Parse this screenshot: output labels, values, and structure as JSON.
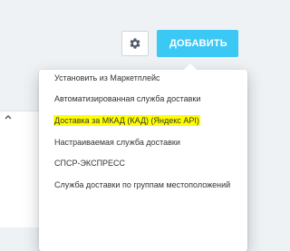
{
  "toolbar": {
    "add_label": "ДОБАВИТЬ",
    "add_color": "#3bc8f5",
    "settings_icon": "gear-icon"
  },
  "panel": {
    "toggle_icon": "chevron-up-icon"
  },
  "menu": {
    "items": [
      {
        "label": "Установить из Маркетплейс"
      },
      {
        "label": "Автоматизированная служба доставки"
      },
      {
        "label": "Доставка за МКАД (КАД) (Яндекс API)",
        "highlight_color": "#ffff00"
      },
      {
        "label": "Настраиваемая служба доставки"
      },
      {
        "label": "СПСР-ЭКСПРЕСС"
      },
      {
        "label": "Служба доставки по группам местоположений"
      }
    ]
  }
}
